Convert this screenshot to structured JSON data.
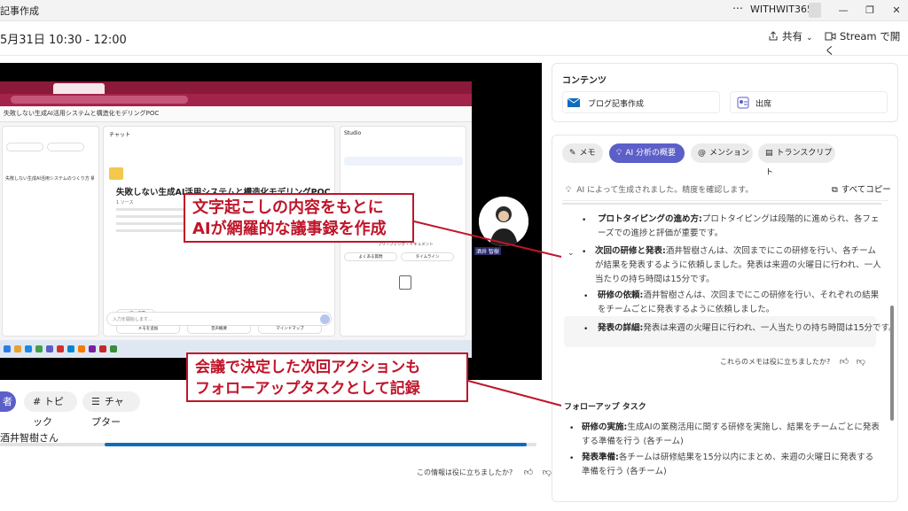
{
  "window": {
    "title": "記事作成",
    "account": "WITHWIT365",
    "more": "⋯",
    "minimize": "—",
    "restore": "❐",
    "close": "✕"
  },
  "header": {
    "meeting_time": "5月31日 10:30 - 12:00",
    "share_label": "共有",
    "stream_label": "Stream で開く"
  },
  "shared_screen": {
    "notebook_title": "失敗しない生成AI活用システムと構造化モデリングPOC",
    "chat_label": "チャット",
    "studio_label": "Studio",
    "doc_title": "失敗しない生成AI活用システムと構造化モデリングPOC",
    "source_label": "1 ソース",
    "left_item": "失敗しない生成AI活用システムのつくり方 構造化モデ...",
    "note_add": "メモを追加",
    "audio_summary": "音声概要",
    "mindmap": "マインドマップ",
    "memo_save": "メモに保存",
    "input_placeholder": "入力を開始します...",
    "faq": "よくある質問",
    "timeline": "タイムライン",
    "briefing": "ブリーフィング・ドキュメント",
    "participant": "酒井 智樹"
  },
  "bottom": {
    "tab_speaker": "者",
    "tab_topic": "# トピック",
    "tab_chapter": "チャプター",
    "speaker_name": "酒井智樹さん",
    "feedback": "この情報は役に立ちましたか?"
  },
  "content": {
    "heading": "コンテンツ",
    "blog": "ブログ記事作成",
    "attend": "出席"
  },
  "notes": {
    "tabs": {
      "memo": "メモ",
      "ai": "AI 分析の概要",
      "mention": "メンション",
      "transcript": "トランスクリプト"
    },
    "ai_note": "AI によって生成されました。精度を確認します。",
    "copy_all": "すべてコピー",
    "proto_label": "プロトタイピングの進め方:",
    "proto_text": "プロトタイピングは段階的に進められ、各フェーズでの進捗と評価が重要です。",
    "next_label": "次回の研修と発表:",
    "next_text": "酒井智樹さんは、次回までにこの研修を行い、各チームが結果を発表するように依頼しました。発表は来週の火曜日に行われ、一人当たりの持ち時間は15分です。",
    "req_label": "研修の依頼:",
    "req_text": "酒井智樹さんは、次回までにこの研修を行い、それぞれの結果をチームごとに発表するように依頼しました。",
    "detail_label": "発表の詳細:",
    "detail_text": "発表は来週の火曜日に行われ、一人当たりの持ち時間は15分です。",
    "feedback": "これらのメモは役に立ちましたか?",
    "followup_heading": "フォローアップ タスク",
    "task1_label": "研修の実施:",
    "task1_text": "生成AIの業務活用に関する研修を実施し、結果をチームごとに発表する準備を行う (各チーム)",
    "task2_label": "発表準備:",
    "task2_text": "各チームは研修結果を15分以内にまとめ、来週の火曜日に発表する準備を行う (各チーム)"
  },
  "callouts": {
    "first_line1": "文字起こしの内容をもとに",
    "first_line2": "AIが網羅的な議事録を作成",
    "second_line1": "会議で決定した次回アクションも",
    "second_line2": "フォローアップタスクとして記録"
  },
  "colors": {
    "accent": "#5b5fc7",
    "callout": "#c0152a",
    "browser": "#8b1a3a"
  }
}
